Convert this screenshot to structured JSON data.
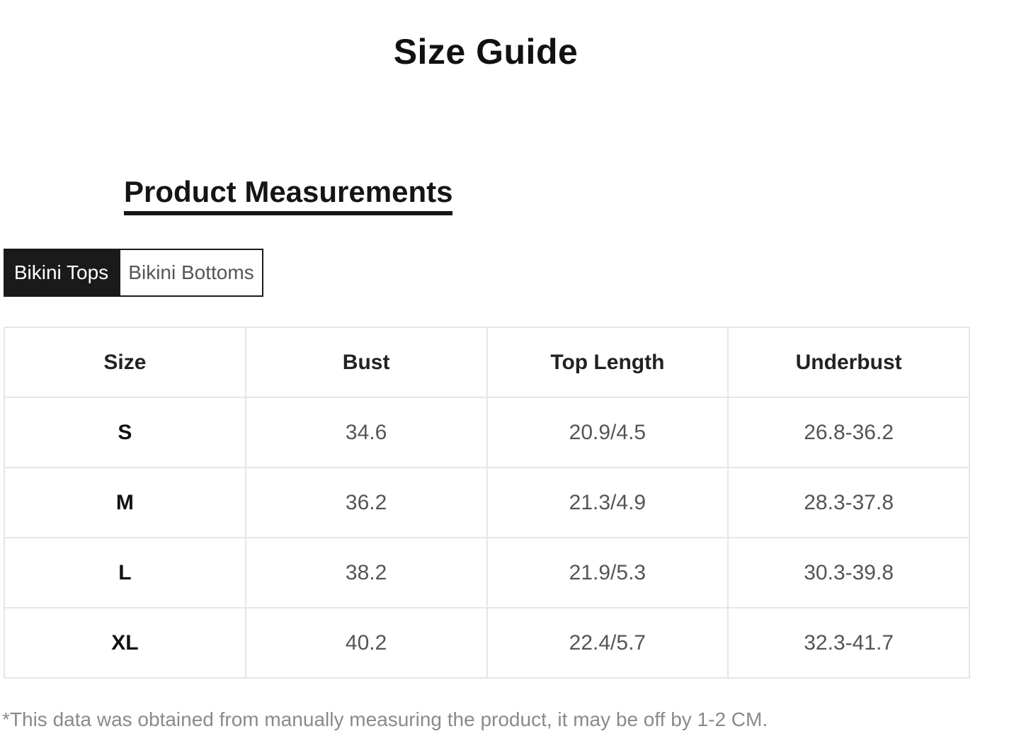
{
  "page": {
    "title": "Size Guide"
  },
  "section": {
    "title": "Product Measurements"
  },
  "tabs": [
    {
      "label": "Bikini Tops",
      "active": true
    },
    {
      "label": "Bikini Bottoms",
      "active": false
    }
  ],
  "table": {
    "headers": [
      "Size",
      "Bust",
      "Top Length",
      "Underbust"
    ],
    "rows": [
      [
        "S",
        "34.6",
        "20.9/4.5",
        "26.8-36.2"
      ],
      [
        "M",
        "36.2",
        "21.3/4.9",
        "28.3-37.8"
      ],
      [
        "L",
        "38.2",
        "21.9/5.3",
        "30.3-39.8"
      ],
      [
        "XL",
        "40.2",
        "22.4/5.7",
        "32.3-41.7"
      ]
    ]
  },
  "footnote": "*This data was obtained from manually measuring the product, it may be off by 1-2 CM.",
  "colors": {
    "active_tab_bg": "#1a1a1a",
    "active_tab_text": "#ffffff",
    "table_border": "#e6e6e6",
    "footnote_text": "#8a8a8a"
  }
}
